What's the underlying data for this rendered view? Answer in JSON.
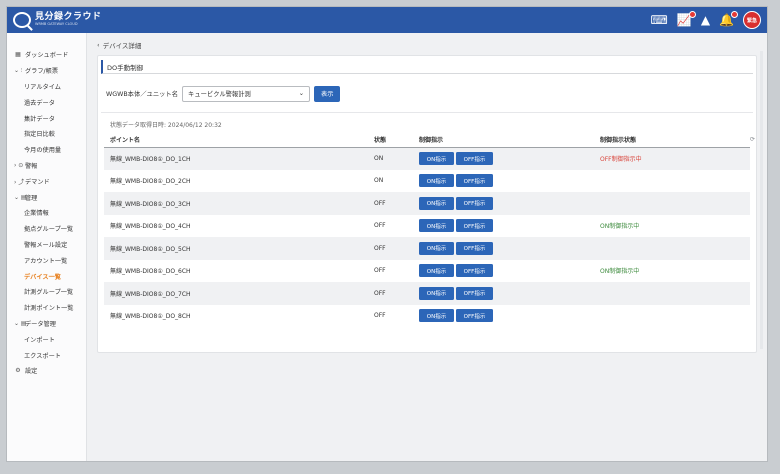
{
  "app": {
    "title": "見分録クラウド",
    "subtitle": "WRMB GATEWAY CLOUD"
  },
  "topbar": {
    "emergency_label": "緊急"
  },
  "sidebar": {
    "items": [
      {
        "label": "ダッシュボード",
        "icon": "▦",
        "level": 0
      },
      {
        "label": "グラフ/帳票",
        "icon": "⌄ ⫶",
        "level": 0
      },
      {
        "label": "リアルタイム",
        "level": 1
      },
      {
        "label": "過去データ",
        "level": 1
      },
      {
        "label": "集計データ",
        "level": 1
      },
      {
        "label": "指定日比較",
        "level": 1
      },
      {
        "label": "今月の使用量",
        "level": 1
      },
      {
        "label": "警報",
        "icon": "› ⊙",
        "level": 0
      },
      {
        "label": "デマンド",
        "icon": "› ⤴",
        "level": 0
      },
      {
        "label": "管理",
        "icon": "⌄ ▤",
        "level": 0
      },
      {
        "label": "企業情報",
        "level": 1
      },
      {
        "label": "拠点グループ一覧",
        "level": 1
      },
      {
        "label": "警報メール設定",
        "level": 1
      },
      {
        "label": "アカウント一覧",
        "level": 1
      },
      {
        "label": "デバイス一覧",
        "level": 1,
        "active": true
      },
      {
        "label": "計測グループ一覧",
        "level": 1
      },
      {
        "label": "計測ポイント一覧",
        "level": 1
      },
      {
        "label": "データ管理",
        "icon": "⌄ ▤",
        "level": 0
      },
      {
        "label": "インポート",
        "level": 1
      },
      {
        "label": "エクスポート",
        "level": 1
      },
      {
        "label": "設定",
        "icon": "⚙",
        "level": 0
      }
    ]
  },
  "main": {
    "back_label": "デバイス詳細",
    "card_title": "DO手動制御",
    "filter_label": "WGWB本体／ユニット名",
    "select_value": "キュービクル警報計測",
    "show_button": "表示",
    "timestamp": "状態データ取得日時: 2024/06/12 20:32",
    "columns": {
      "name": "ポイント名",
      "state": "状態",
      "control": "制御指示",
      "status": "制御指示状態"
    },
    "on_label": "ON指示",
    "off_label": "OFF指示",
    "rows": [
      {
        "name": "無線_WMB-DIO8①_DO_1CH",
        "state": "ON",
        "status": "OFF制御指示中",
        "status_type": "off"
      },
      {
        "name": "無線_WMB-DIO8①_DO_2CH",
        "state": "ON",
        "status": "",
        "status_type": ""
      },
      {
        "name": "無線_WMB-DIO8①_DO_3CH",
        "state": "OFF",
        "status": "",
        "status_type": ""
      },
      {
        "name": "無線_WMB-DIO8①_DO_4CH",
        "state": "OFF",
        "status": "ON制御指示中",
        "status_type": "on"
      },
      {
        "name": "無線_WMB-DIO8①_DO_5CH",
        "state": "OFF",
        "status": "",
        "status_type": ""
      },
      {
        "name": "無線_WMB-DIO8①_DO_6CH",
        "state": "OFF",
        "status": "ON制御指示中",
        "status_type": "on"
      },
      {
        "name": "無線_WMB-DIO8①_DO_7CH",
        "state": "OFF",
        "status": "",
        "status_type": ""
      },
      {
        "name": "無線_WMB-DIO8①_DO_8CH",
        "state": "OFF",
        "status": "",
        "status_type": ""
      }
    ]
  },
  "colors": {
    "primary": "#2b58a6",
    "button": "#2c66b8",
    "active_nav": "#e77f1d",
    "status_off": "#d9443a",
    "status_on": "#3d8b3d"
  }
}
